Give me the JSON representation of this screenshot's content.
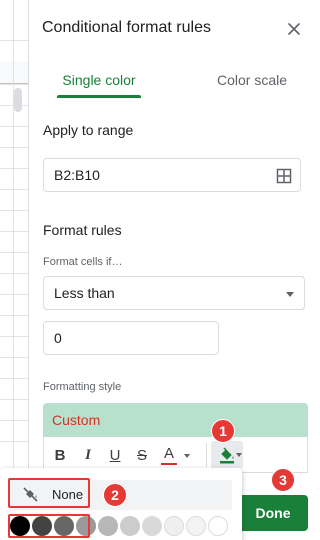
{
  "panel": {
    "title": "Conditional format rules",
    "close_icon": "close-icon"
  },
  "tabs": [
    {
      "label": "Single color",
      "active": true
    },
    {
      "label": "Color scale",
      "active": false
    }
  ],
  "apply_range": {
    "heading": "Apply to range",
    "value": "B2:B10",
    "icon": "select-range-grid-icon"
  },
  "format_rules": {
    "heading": "Format rules",
    "condition_label": "Format cells if…",
    "condition_value": "Less than",
    "value_input": "0"
  },
  "formatting_style": {
    "label": "Formatting style",
    "preview_text": "Custom",
    "preview_bg": "#b7e1cd",
    "preview_text_color": "#d93025",
    "toolbar": {
      "bold": "B",
      "italic": "I",
      "underline": "U",
      "strikethrough": "S",
      "text_color": "A",
      "text_color_bar": "#d93025",
      "fill_icon": "fill-color-icon"
    }
  },
  "done_label": "Done",
  "accent_color": "#188038",
  "fill_menu": {
    "none_label": "None",
    "none_icon": "no-fill-icon",
    "swatches": [
      "#000000",
      "#434343",
      "#666666",
      "#999999",
      "#b7b7b7",
      "#cccccc",
      "#d9d9d9",
      "#efefef",
      "#f3f3f3",
      "#ffffff"
    ]
  },
  "steps": [
    "1",
    "2",
    "3"
  ]
}
